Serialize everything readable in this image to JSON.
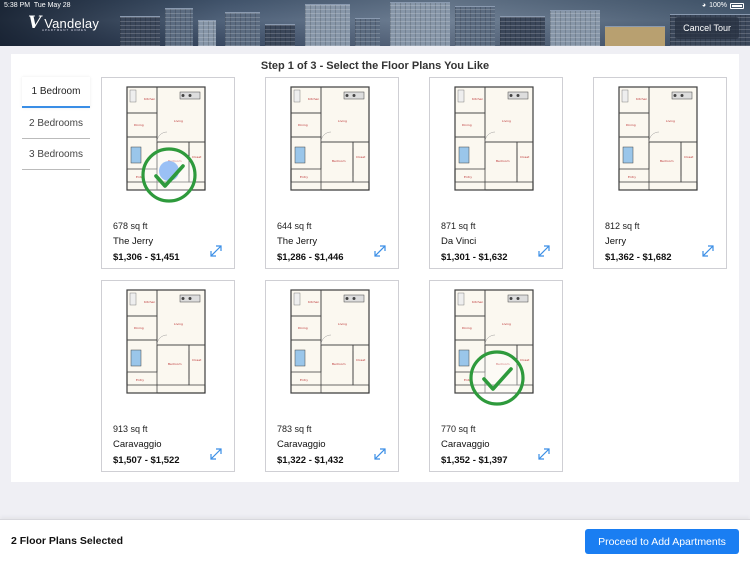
{
  "status_bar": {
    "time": "5:38 PM",
    "date": "Tue May 28",
    "battery": "100%"
  },
  "brand": {
    "mark": "V",
    "name": "Vandelay",
    "sub": "APARTMENT HOMES"
  },
  "header": {
    "cancel_label": "Cancel Tour"
  },
  "step_title": "Step 1 of 3 - Select the Floor Plans You Like",
  "tabs": [
    {
      "label": "1 Bedroom",
      "active": true
    },
    {
      "label": "2 Bedrooms",
      "active": false
    },
    {
      "label": "3 Bedrooms",
      "active": false
    }
  ],
  "cards": [
    {
      "sqft": "678 sq ft",
      "name": "The Jerry",
      "price": "$1,306 - $1,451",
      "selected": true
    },
    {
      "sqft": "644 sq ft",
      "name": "The Jerry",
      "price": "$1,286 - $1,446",
      "selected": false
    },
    {
      "sqft": "871 sq ft",
      "name": "Da Vinci",
      "price": "$1,301 - $1,632",
      "selected": false
    },
    {
      "sqft": "812 sq ft",
      "name": "Jerry",
      "price": "$1,362 - $1,682",
      "selected": false
    },
    {
      "sqft": "913 sq ft",
      "name": "Caravaggio",
      "price": "$1,507 - $1,522",
      "selected": false
    },
    {
      "sqft": "783 sq ft",
      "name": "Caravaggio",
      "price": "$1,322 - $1,432",
      "selected": false
    },
    {
      "sqft": "770 sq ft",
      "name": "Caravaggio",
      "price": "$1,352 - $1,397",
      "selected": true
    }
  ],
  "footer": {
    "selected_text": "2 Floor Plans Selected",
    "proceed_label": "Proceed to Add Apartments"
  },
  "colors": {
    "accent": "#1a7ef2",
    "check": "#2e9a3c",
    "tap_dot": "#4a8ef0"
  }
}
